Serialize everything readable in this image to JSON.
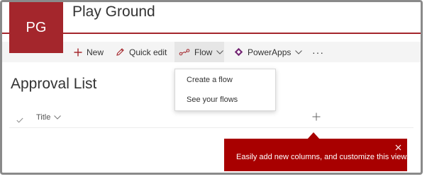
{
  "site": {
    "logo_initials": "PG",
    "title": "Play Ground"
  },
  "command_bar": {
    "new_label": "New",
    "quick_edit_label": "Quick edit",
    "flow_label": "Flow",
    "powerapps_label": "PowerApps",
    "more_label": "···"
  },
  "flow_menu": {
    "items": [
      {
        "label": "Create a flow"
      },
      {
        "label": "See your flows"
      }
    ]
  },
  "list": {
    "title": "Approval List",
    "columns": [
      {
        "label": "Title"
      }
    ]
  },
  "teaching_bubble": {
    "text": "Easily add new columns, and customize this view."
  },
  "colors": {
    "brand": "#a4262c",
    "bubble": "#a80000",
    "command_bar_bg": "#f4f4f4",
    "flow_active_bg": "#e6e6e6",
    "powerapps_icon": "#742774"
  }
}
